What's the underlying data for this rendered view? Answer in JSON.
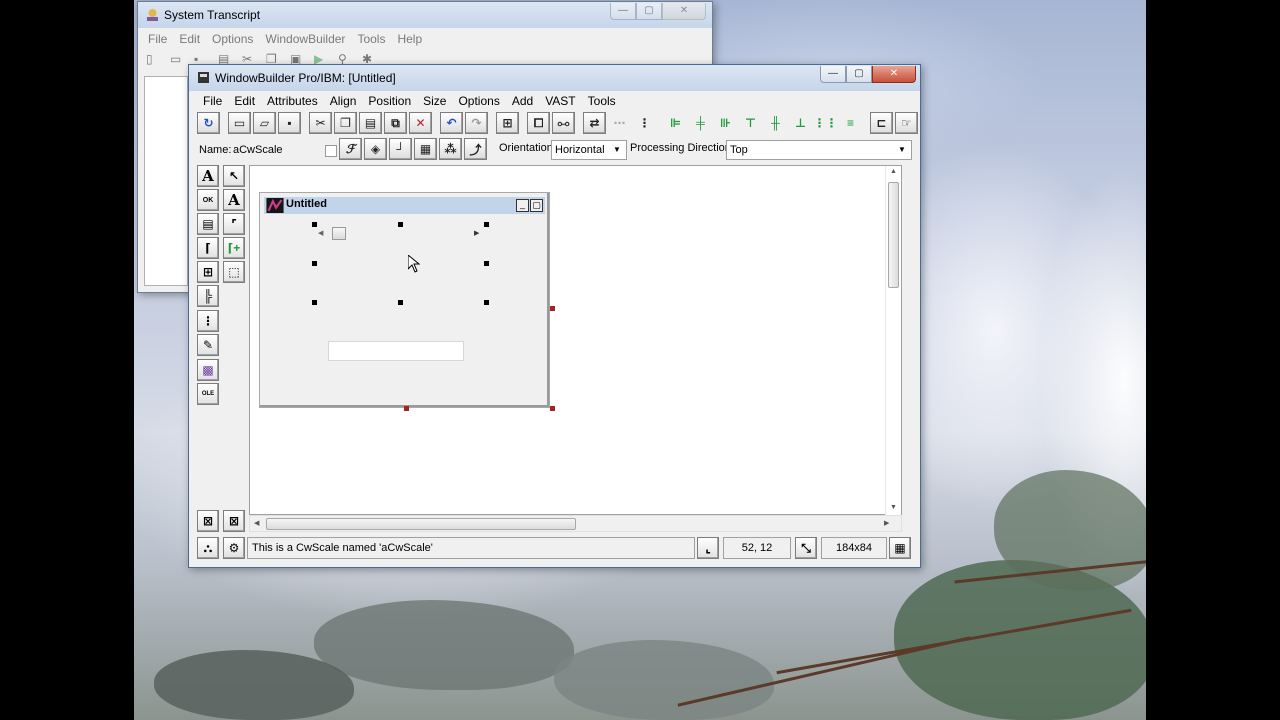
{
  "transcript": {
    "title": "System Transcript",
    "menu": [
      "File",
      "Edit",
      "Options",
      "WindowBuilder",
      "Tools",
      "Help"
    ]
  },
  "wb": {
    "title": "WindowBuilder Pro/IBM: [Untitled]",
    "menu": [
      "File",
      "Edit",
      "Attributes",
      "Align",
      "Position",
      "Size",
      "Options",
      "Add",
      "VAST",
      "Tools"
    ],
    "name_label": "Name:",
    "name_value": "aCwScale",
    "orientation_label": "Orientation:",
    "orientation_value": "Horizontal",
    "processing_label": "Processing Direction:",
    "processing_value": "Top",
    "status_text": "This is a CwScale named 'aCwScale'",
    "position_readout": "52, 12",
    "size_readout": "184x84"
  },
  "canvas": {
    "form_title": "Untitled"
  },
  "icons": {
    "transcript": "vast-logo-icon",
    "wb": "window-builder-icon",
    "form": "vast-form-icon"
  },
  "colors": {
    "title_active": "#c6d5ea",
    "close_button": "#c7503a",
    "selection_handle": "#a32424"
  }
}
